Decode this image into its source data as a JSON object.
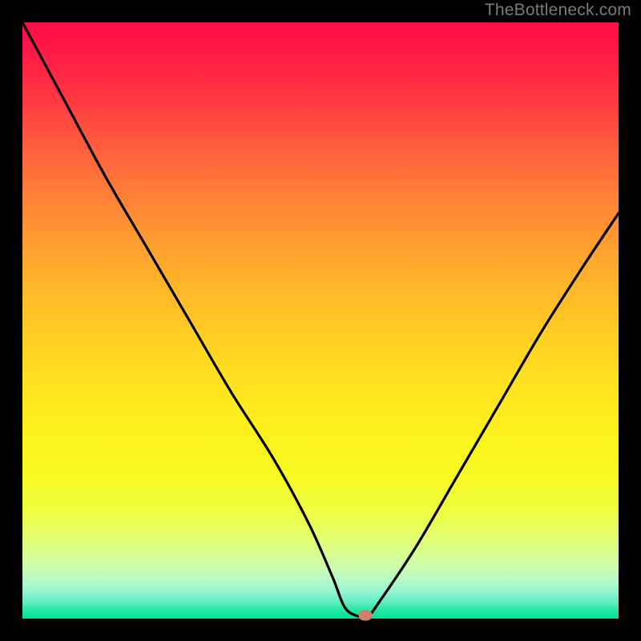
{
  "watermark": "TheBottleneck.com",
  "colors": {
    "page_bg": "#000000",
    "curve": "#000000",
    "marker": "#cf7f6e",
    "watermark": "#7a7a7a"
  },
  "chart_data": {
    "type": "line",
    "title": "",
    "xlabel": "",
    "ylabel": "",
    "xlim": [
      0,
      100
    ],
    "ylim": [
      0,
      100
    ],
    "grid": false,
    "legend": false,
    "series": [
      {
        "name": "bottleneck-curve",
        "x": [
          0,
          7,
          14,
          21,
          28,
          35,
          42,
          48,
          52,
          54,
          56,
          58,
          60,
          66,
          73,
          80,
          87,
          94,
          100
        ],
        "values": [
          100,
          87,
          74,
          62,
          50,
          38,
          27,
          16,
          7,
          2,
          0.5,
          0.5,
          3,
          12,
          24,
          36,
          48,
          59,
          68
        ]
      }
    ],
    "marker": {
      "x": 57.5,
      "y": 0.5
    },
    "background_gradient": {
      "direction": "vertical",
      "stops": [
        {
          "pos": 0,
          "color": "#ff0e48"
        },
        {
          "pos": 0.5,
          "color": "#ffcd24"
        },
        {
          "pos": 0.82,
          "color": "#eefd41"
        },
        {
          "pos": 1.0,
          "color": "#05e090"
        }
      ]
    }
  }
}
